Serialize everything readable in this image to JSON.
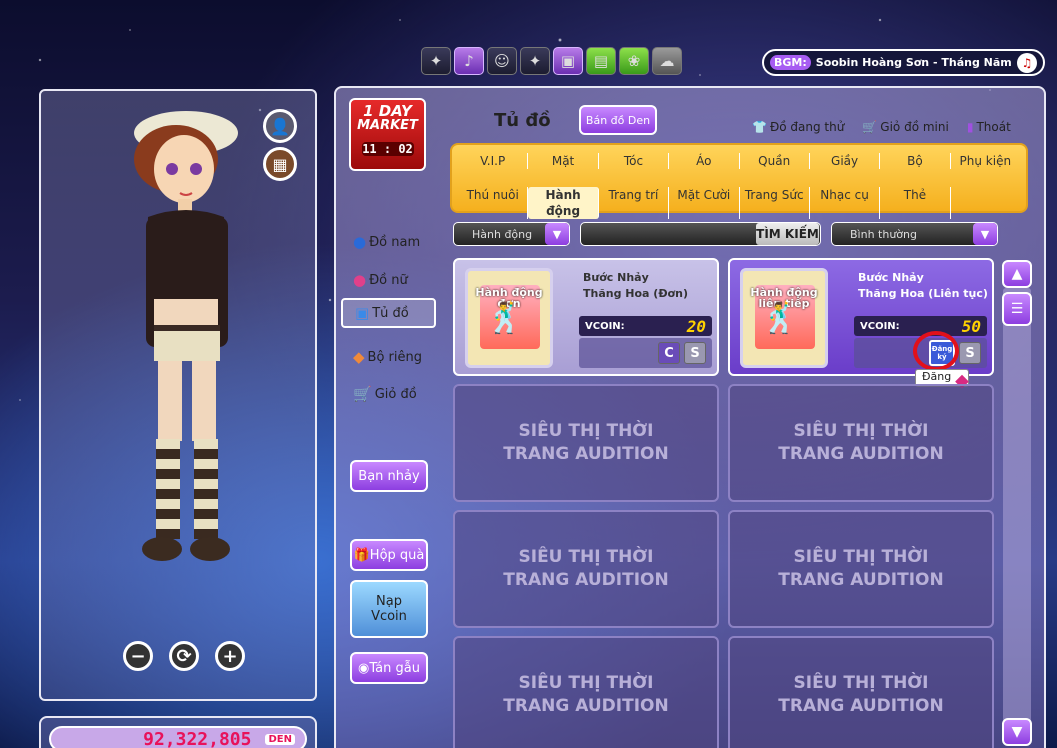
{
  "bgm": {
    "label": "BGM:",
    "song": "Soobin Hoàng Sơn - Tháng Năm"
  },
  "top_icons": [
    "dark-icon",
    "purple-icon",
    "face-icon",
    "dark-icon",
    "gift-tv-icon",
    "photo-icon",
    "khuvuon-icon",
    "cloud-icon"
  ],
  "market": {
    "line1": "1 DAY",
    "line2": "MARKET",
    "time": "11 : 02"
  },
  "title": "Tủ đồ",
  "sell_button": "Bán đồ Den",
  "top_links": {
    "trying": "Đồ đang thử",
    "mini_cart": "Giỏ đồ mini",
    "exit": "Thoát"
  },
  "categories_row1": [
    "V.I.P",
    "Mặt",
    "Tóc",
    "Áo",
    "Quần",
    "Giầy",
    "Bộ",
    "Phụ kiện"
  ],
  "categories_row2": [
    "Thú nuôi",
    "Hành động",
    "Trang trí",
    "Mặt Cười",
    "Trang Sức",
    "Nhạc cụ",
    "Thẻ",
    ""
  ],
  "filters": {
    "type": "Hành động",
    "search_button": "TÌM KIẾM",
    "sort": "Bình thường"
  },
  "nav": {
    "male": "Đồ nam",
    "female": "Đồ nữ",
    "wardrobe": "Tủ đồ",
    "private": "Bộ riêng",
    "cart": "Giỏ đồ"
  },
  "side_buttons": {
    "dance_partner": "Bạn nhảy",
    "gift_box": "Hộp quà",
    "topup_line1": "Nạp",
    "topup_line2": "Vcoin",
    "chat": "Tán gẫu"
  },
  "items": [
    {
      "tag": "Hành động đơn",
      "name_line1": "Bước Nhảy",
      "name_line2": "Thăng Hoa (Đơn)",
      "price_label": "VCOIN:",
      "price": "20",
      "btn1": "C",
      "btn2": "S"
    },
    {
      "tag": "Hành động liên tiếp",
      "name_line1": "Bước Nhảy",
      "name_line2": "Thăng Hoa (Liên tục)",
      "price_label": "VCOIN:",
      "price": "50",
      "btn1": "Đăng ký",
      "btn2": "S"
    }
  ],
  "register_tooltip": "Đăng",
  "placeholder": {
    "line1": "SIÊU THỊ THỜI",
    "line2": "TRANG AUDITION"
  },
  "money": {
    "amount": "92,322,805",
    "currency": "DEN"
  }
}
